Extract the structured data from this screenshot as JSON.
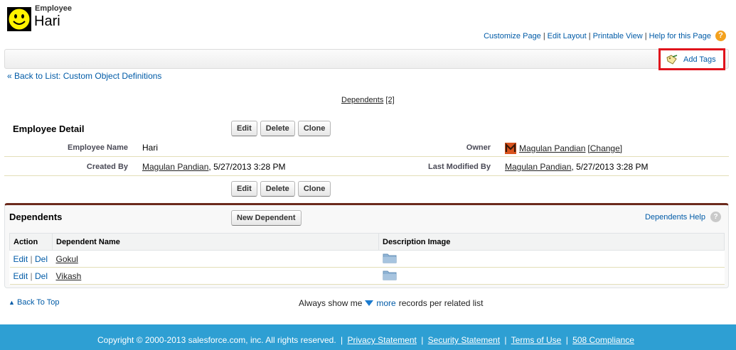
{
  "header": {
    "object_type": "Employee",
    "record_name": "Hari"
  },
  "page_links": {
    "customize_page": "Customize Page",
    "edit_layout": "Edit Layout",
    "printable_view": "Printable View",
    "help": "Help for this Page",
    "help_icon": "?",
    "separator": "|"
  },
  "tags": {
    "add_tags": "Add Tags"
  },
  "back_to_list": "« Back to List: Custom Object Definitions",
  "related_link": {
    "label": "Dependents",
    "count": "[2]"
  },
  "detail": {
    "title": "Employee Detail",
    "buttons": [
      "Edit",
      "Delete",
      "Clone"
    ],
    "fields": {
      "employee_name_label": "Employee Name",
      "employee_name": "Hari",
      "owner_label": "Owner",
      "owner": "Magulan Pandian",
      "owner_change": "[Change]",
      "created_by_label": "Created By",
      "created_by_user": "Magulan Pandian",
      "created_by_date": ", 5/27/2013 3:28 PM",
      "last_modified_label": "Last Modified By",
      "last_modified_user": "Magulan Pandian",
      "last_modified_date": ", 5/27/2013 3:28 PM"
    }
  },
  "dependents": {
    "title": "Dependents",
    "new_button": "New Dependent",
    "help": "Dependents Help",
    "help_icon": "?",
    "columns": [
      "Action",
      "Dependent Name",
      "Description Image"
    ],
    "rows": [
      {
        "edit": "Edit",
        "sep": "|",
        "del": "Del",
        "name": "Gokul"
      },
      {
        "edit": "Edit",
        "sep": "|",
        "del": "Del",
        "name": "Vikash"
      }
    ]
  },
  "bottom": {
    "back_to_top": "Back To Top",
    "always_show": "Always show me",
    "more": "more",
    "records_per": "records per related list"
  },
  "footer": {
    "copyright": "Copyright © 2000-2013 salesforce.com, inc. All rights reserved.",
    "links": [
      "Privacy Statement",
      "Security Statement",
      "Terms of Use",
      "508 Compliance"
    ],
    "separator": "|"
  },
  "colors": {
    "link": "#015ba7",
    "footer_bg": "#2e9fd3",
    "highlight_box": "#e0131c",
    "related_accent": "#6b2a1c",
    "folder_icon": "#8fb3d4"
  }
}
